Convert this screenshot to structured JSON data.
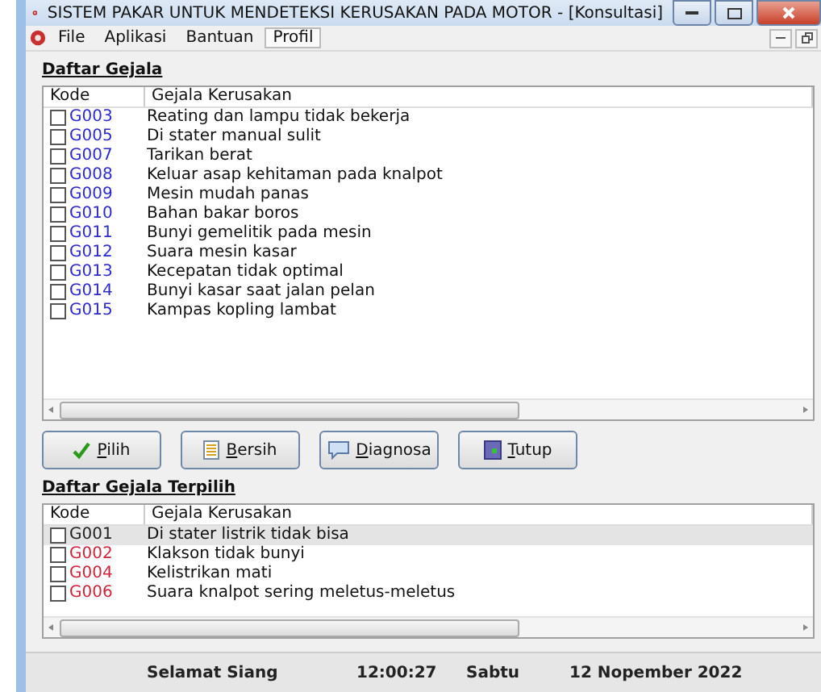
{
  "window": {
    "title": "SISTEM  PAKAR UNTUK MENDETEKSI KERUSAKAN PADA MOTOR - [Konsultasi]"
  },
  "menu": [
    {
      "label": "File",
      "selected": false
    },
    {
      "label": "Aplikasi",
      "selected": false
    },
    {
      "label": "Bantuan",
      "selected": false
    },
    {
      "label": "Profil",
      "selected": true
    }
  ],
  "gejala": {
    "heading": "Daftar Gejala",
    "columns": [
      "Kode",
      "Gejala Kerusakan"
    ],
    "rows": [
      {
        "code": "G003",
        "text": "Reating dan lampu tidak bekerja",
        "checked": false,
        "color": "#2a2ad0",
        "selected": false
      },
      {
        "code": "G005",
        "text": "Di stater manual sulit",
        "checked": false,
        "color": "#2a2ad0",
        "selected": false
      },
      {
        "code": "G007",
        "text": "Tarikan berat",
        "checked": false,
        "color": "#2a2ad0",
        "selected": false
      },
      {
        "code": "G008",
        "text": "Keluar asap kehitaman pada knalpot",
        "checked": false,
        "color": "#2a2ad0",
        "selected": false
      },
      {
        "code": "G009",
        "text": "Mesin mudah panas",
        "checked": false,
        "color": "#2a2ad0",
        "selected": false
      },
      {
        "code": "G010",
        "text": "Bahan bakar boros",
        "checked": false,
        "color": "#2a2ad0",
        "selected": false
      },
      {
        "code": "G011",
        "text": "Bunyi gemelitik pada mesin",
        "checked": false,
        "color": "#2a2ad0",
        "selected": false
      },
      {
        "code": "G012",
        "text": "Suara mesin kasar",
        "checked": false,
        "color": "#2a2ad0",
        "selected": false
      },
      {
        "code": "G013",
        "text": "Kecepatan tidak optimal",
        "checked": false,
        "color": "#2a2ad0",
        "selected": false
      },
      {
        "code": "G014",
        "text": "Bunyi kasar saat jalan pelan",
        "checked": false,
        "color": "#2a2ad0",
        "selected": false
      },
      {
        "code": "G015",
        "text": "Kampas kopling lambat",
        "checked": false,
        "color": "#2a2ad0",
        "selected": false
      }
    ]
  },
  "buttons": [
    {
      "label": "Pilih",
      "kind": "check"
    },
    {
      "label": "Bersih",
      "kind": "document"
    },
    {
      "label": "Diagnosa",
      "kind": "chat"
    },
    {
      "label": "Tutup",
      "kind": "door"
    }
  ],
  "terpilih": {
    "heading": "Daftar Gejala Terpilih",
    "columns": [
      "Kode",
      "Gejala Kerusakan"
    ],
    "rows": [
      {
        "code": "G001",
        "text": "Di stater listrik tidak bisa",
        "checked": false,
        "color": "#222222",
        "selected": true
      },
      {
        "code": "G002",
        "text": "Klakson tidak bunyi",
        "checked": false,
        "color": "#d0243a",
        "selected": false
      },
      {
        "code": "G004",
        "text": "Kelistrikan mati",
        "checked": false,
        "color": "#d0243a",
        "selected": false
      },
      {
        "code": "G006",
        "text": "Suara knalpot sering meletus-meletus",
        "checked": false,
        "color": "#d0243a",
        "selected": false
      }
    ]
  },
  "status_bar": {
    "greeting": "Selamat Siang",
    "time": "12:00:27",
    "day": "Sabtu",
    "date": "12 Nopember 2022"
  }
}
